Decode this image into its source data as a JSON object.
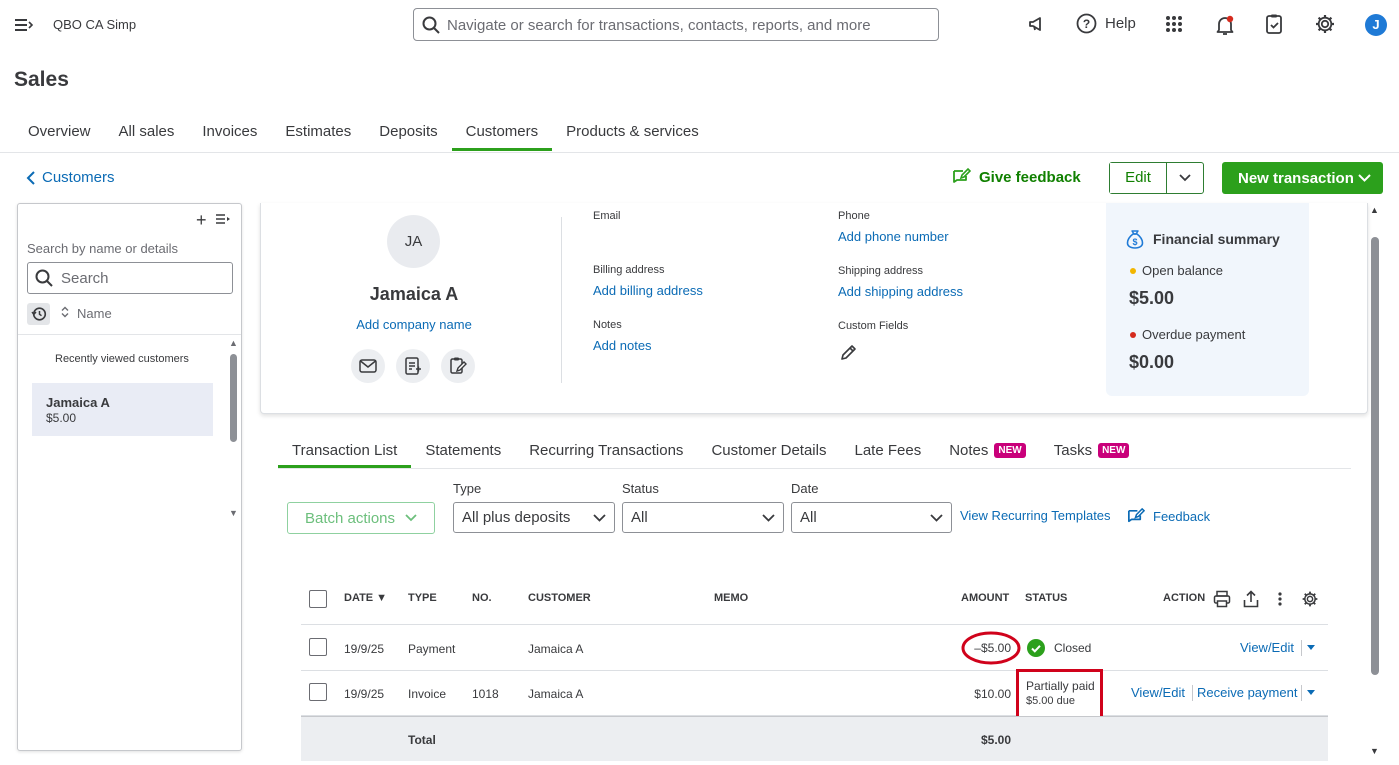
{
  "header": {
    "company": "QBO CA Simp",
    "search_placeholder": "Navigate or search for transactions, contacts, reports, and more",
    "help_label": "Help",
    "avatar_initial": "J"
  },
  "page": {
    "title": "Sales",
    "tabs": [
      "Overview",
      "All sales",
      "Invoices",
      "Estimates",
      "Deposits",
      "Customers",
      "Products & services"
    ],
    "active_tab": "Customers"
  },
  "actions": {
    "back_label": "Customers",
    "give_feedback": "Give feedback",
    "edit": "Edit",
    "new_transaction": "New transaction"
  },
  "left_panel": {
    "search_label": "Search by name or details",
    "search_placeholder": "Search",
    "sort_label": "Name",
    "recent_heading": "Recently viewed customers",
    "customers": [
      {
        "name": "Jamaica A",
        "balance": "$5.00"
      }
    ]
  },
  "customer": {
    "initials": "JA",
    "name": "Jamaica A",
    "add_company": "Add company name",
    "email_label": "Email",
    "phone_label": "Phone",
    "phone_link": "Add phone number",
    "billing_label": "Billing address",
    "billing_link": "Add billing address",
    "shipping_label": "Shipping address",
    "shipping_link": "Add shipping address",
    "notes_label": "Notes",
    "notes_link": "Add notes",
    "custom_fields_label": "Custom Fields"
  },
  "financial_summary": {
    "title": "Financial summary",
    "open_balance_label": "Open balance",
    "open_balance": "$5.00",
    "overdue_label": "Overdue payment",
    "overdue": "$0.00",
    "colors": {
      "open": "#f2b600",
      "overdue": "#d52b1e"
    }
  },
  "detail_tabs": {
    "items": [
      "Transaction List",
      "Statements",
      "Recurring Transactions",
      "Customer Details",
      "Late Fees",
      "Notes",
      "Tasks"
    ],
    "badge": "NEW"
  },
  "filters": {
    "batch_actions": "Batch actions",
    "type_label": "Type",
    "type_value": "All plus deposits",
    "status_label": "Status",
    "status_value": "All",
    "date_label": "Date",
    "date_value": "All",
    "view_recurring": "View Recurring Templates",
    "feedback": "Feedback"
  },
  "table": {
    "columns": [
      "DATE ▼",
      "TYPE",
      "NO.",
      "CUSTOMER",
      "MEMO",
      "AMOUNT",
      "STATUS",
      "ACTION"
    ],
    "rows": [
      {
        "date": "19/9/25",
        "type": "Payment",
        "no": "",
        "customer": "Jamaica A",
        "memo": "",
        "amount": "–$5.00",
        "status": "Closed",
        "status_sub": "",
        "actions": [
          "View/Edit"
        ]
      },
      {
        "date": "19/9/25",
        "type": "Invoice",
        "no": "1018",
        "customer": "Jamaica A",
        "memo": "",
        "amount": "$10.00",
        "status": "Partially paid",
        "status_sub": "$5.00 due",
        "actions": [
          "View/Edit",
          "Receive payment"
        ]
      }
    ],
    "total_label": "Total",
    "total_amount": "$5.00"
  },
  "annotation_color": "#d0021b"
}
